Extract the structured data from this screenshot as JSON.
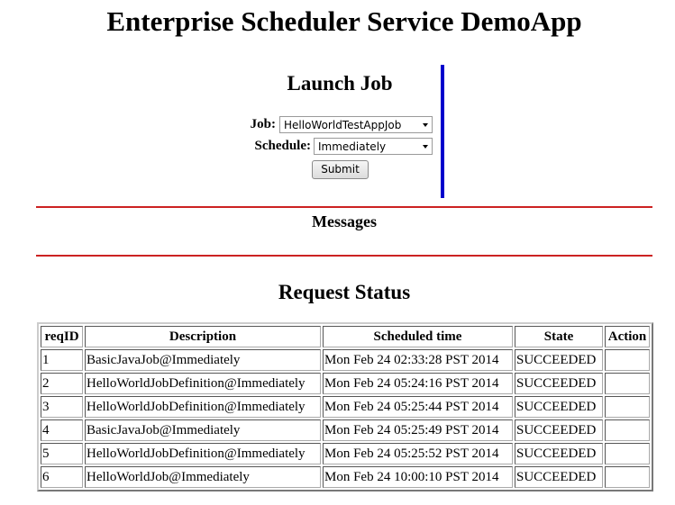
{
  "page": {
    "title": "Enterprise Scheduler Service DemoApp"
  },
  "launch": {
    "heading": "Launch Job",
    "job_label": "Job:",
    "job_value": "HelloWorldTestAppJob",
    "schedule_label": "Schedule:",
    "schedule_value": "Immediately",
    "submit_label": "Submit"
  },
  "messages": {
    "heading": "Messages"
  },
  "status": {
    "heading": "Request Status",
    "columns": [
      "reqID",
      "Description",
      "Scheduled time",
      "State",
      "Action"
    ],
    "rows": [
      {
        "id": "1",
        "description": "BasicJavaJob@Immediately",
        "time": "Mon Feb 24 02:33:28 PST 2014",
        "state": "SUCCEEDED",
        "action": ""
      },
      {
        "id": "2",
        "description": "HelloWorldJobDefinition@Immediately",
        "time": "Mon Feb 24 05:24:16 PST 2014",
        "state": "SUCCEEDED",
        "action": ""
      },
      {
        "id": "3",
        "description": "HelloWorldJobDefinition@Immediately",
        "time": "Mon Feb 24 05:25:44 PST 2014",
        "state": "SUCCEEDED",
        "action": ""
      },
      {
        "id": "4",
        "description": "BasicJavaJob@Immediately",
        "time": "Mon Feb 24 05:25:49 PST 2014",
        "state": "SUCCEEDED",
        "action": ""
      },
      {
        "id": "5",
        "description": "HelloWorldJobDefinition@Immediately",
        "time": "Mon Feb 24 05:25:52 PST 2014",
        "state": "SUCCEEDED",
        "action": ""
      },
      {
        "id": "6",
        "description": "HelloWorldJob@Immediately",
        "time": "Mon Feb 24 10:00:10 PST 2014",
        "state": "SUCCEEDED",
        "action": ""
      }
    ]
  },
  "colors": {
    "divider_red": "#cc2222",
    "divider_blue": "#0000cc"
  }
}
